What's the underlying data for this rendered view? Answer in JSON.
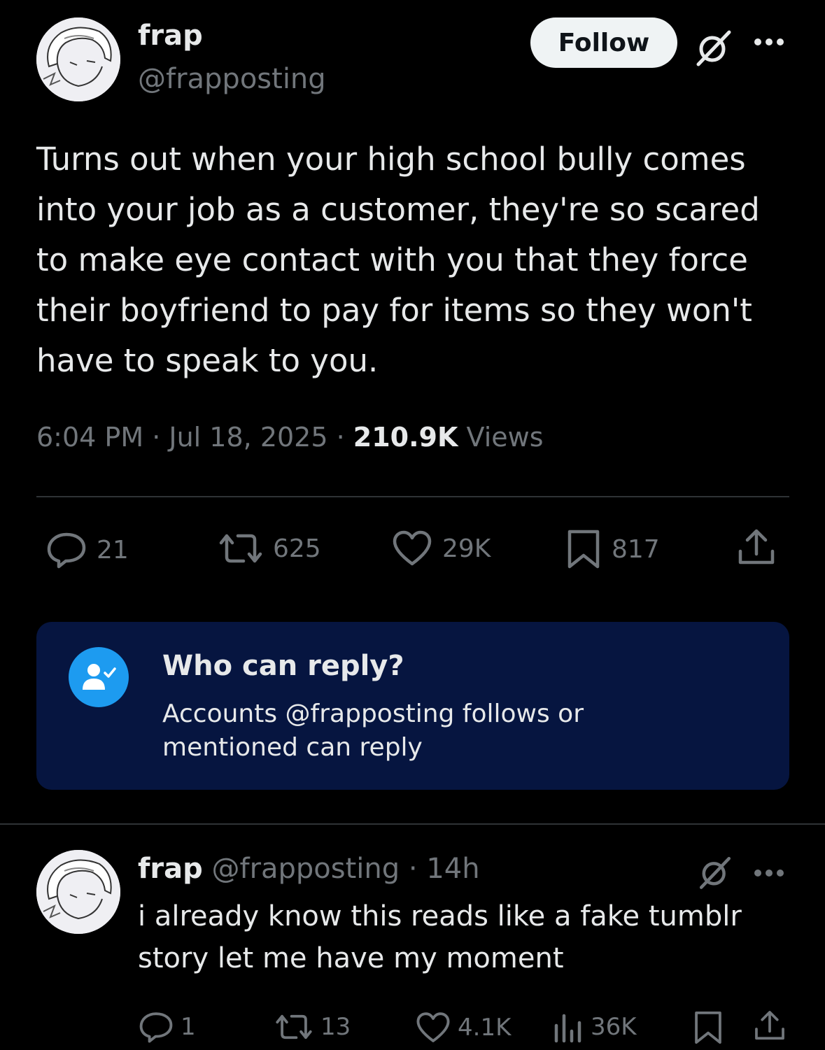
{
  "post": {
    "author": {
      "display_name": "frap",
      "handle": "@frapposting"
    },
    "follow_label": "Follow",
    "text": "Turns out when your high school bully comes into your job as a customer, they're so scared to make eye contact with you that they force their boyfriend to pay for items so they won't have to speak to you.",
    "time": "6:04 PM",
    "date": "Jul 18, 2025",
    "separator": " · ",
    "views_count": "210.9K",
    "views_label": "Views",
    "actions": {
      "replies": "21",
      "reposts": "625",
      "likes": "29K",
      "bookmarks": "817"
    }
  },
  "reply_restriction": {
    "title": "Who can reply?",
    "description": "Accounts @frapposting follows or mentioned can reply"
  },
  "reply": {
    "display_name": "frap",
    "handle": "@frapposting",
    "separator": " · ",
    "time": "14h",
    "text": "i already know this reads like a fake tumblr story let me have my moment",
    "actions": {
      "replies": "1",
      "reposts": "13",
      "likes": "4.1K",
      "views": "36K"
    }
  },
  "colors": {
    "background": "#000000",
    "text_primary": "#e7e9ea",
    "text_secondary": "#71767b",
    "accent": "#1d9bf0",
    "info_box": "#061540",
    "divider": "#2f3336"
  }
}
